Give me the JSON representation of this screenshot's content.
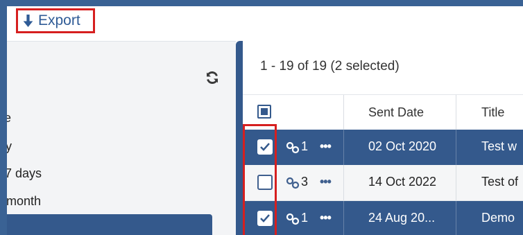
{
  "toolbar": {
    "export_label": "Export"
  },
  "left_panel": {
    "items": [
      {
        "label": "e"
      },
      {
        "label": "y"
      },
      {
        "label": "7 days"
      },
      {
        "label": "month"
      }
    ]
  },
  "grid": {
    "count_text": "1 - 19 of 19 (2 selected)",
    "columns": {
      "sent_date": "Sent Date",
      "title": "Title"
    },
    "rows": [
      {
        "selected": true,
        "links": "1",
        "sent_date": "02 Oct 2020",
        "title": "Test w"
      },
      {
        "selected": false,
        "links": "3",
        "sent_date": "14 Oct 2022",
        "title": "Test of"
      },
      {
        "selected": true,
        "links": "1",
        "sent_date": "24 Aug 20...",
        "title": "Demo"
      }
    ]
  },
  "colors": {
    "accent": "#34598c",
    "highlight": "#d61f1f",
    "link_text": "#2f5b96"
  }
}
